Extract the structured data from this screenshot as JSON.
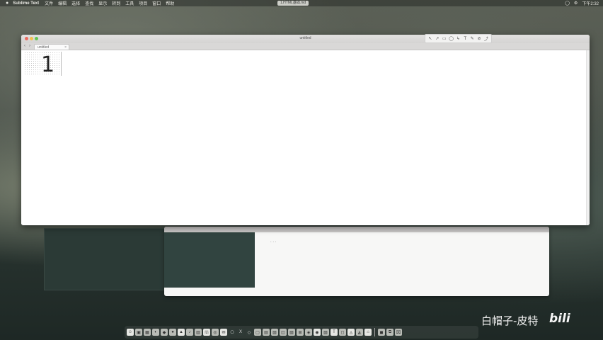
{
  "menubar": {
    "apple_icon": "apple-icon",
    "app_name": "Sublime Text",
    "items": [
      "文件",
      "编辑",
      "选择",
      "查找",
      "显示",
      "转到",
      "工具",
      "项目",
      "窗口",
      "帮助"
    ],
    "active_doc": "1.HTML基础.md",
    "right_icons": [
      "circle-icon",
      "gear-icon",
      "time"
    ],
    "time": "下午2:32"
  },
  "window": {
    "title": "untitled",
    "tab_label": "untitled",
    "line_number": "1"
  },
  "float_toolbar": {
    "tools": [
      "↖",
      "↗",
      "▭",
      "◯",
      "↳",
      "T",
      "✎",
      "⊘",
      "⤴"
    ]
  },
  "dock": {
    "items": [
      "☺",
      "▣",
      "▦",
      "◐",
      "◆",
      "●",
      "▲",
      "♪",
      "▥",
      "☏",
      "◎",
      "✉",
      "⎔",
      "X",
      "◇",
      "▢",
      "▤",
      "▧",
      "◫",
      "▨",
      "⊞",
      "◈",
      "◉",
      "▧",
      "T",
      "◻",
      "◬",
      "◭",
      "⌂",
      "◼",
      "⧉",
      "⌧"
    ]
  },
  "watermark": {
    "text": "白帽子-皮特",
    "logo": "bilibili"
  }
}
